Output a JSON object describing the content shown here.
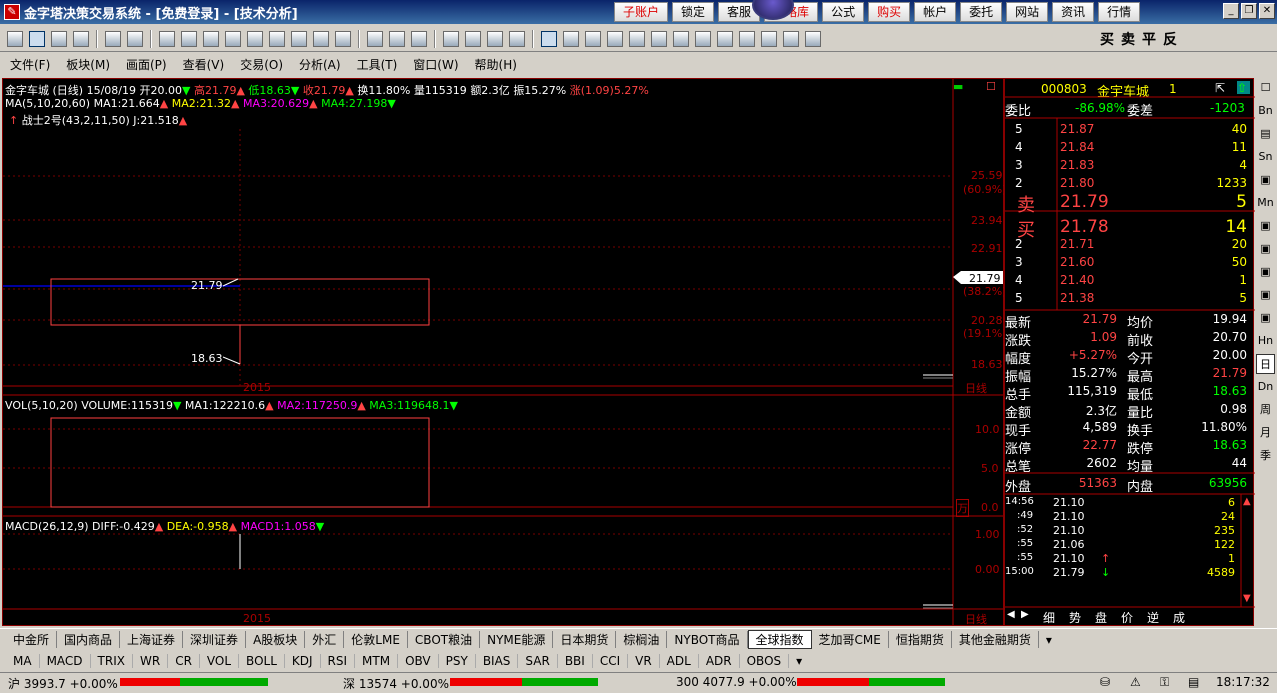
{
  "app": {
    "title": "金字塔决策交易系统 - [免费登录] - [技术分析]",
    "logo": "app-logo-icon"
  },
  "title_buttons": [
    "子账户",
    "锁定",
    "客服",
    "策略库",
    "公式",
    "购买",
    "帐户",
    "委托",
    "网站",
    "资讯",
    "行情"
  ],
  "trade_buttons": [
    "买",
    "卖",
    "平",
    "反"
  ],
  "menu": [
    "文件(F)",
    "板块(M)",
    "画面(P)",
    "查看(V)",
    "交易(O)",
    "分析(A)",
    "工具(T)",
    "窗口(W)",
    "帮助(H)"
  ],
  "chart": {
    "header": "金字车城 (日线) 15/08/19",
    "open": "开20.00",
    "high": "高21.79",
    "low": "低18.63",
    "close": "收21.79",
    "turnover": "换11.80%",
    "volume": "量115319",
    "amount": "额2.3亿",
    "amplitude": "振15.27%",
    "change": "涨(1.09)5.27%",
    "ma_line": "MA(5,10,20,60)",
    "ma1": "MA1:21.664",
    "ma2": "MA2:21.32",
    "ma3": "MA3:20.629",
    "ma4": "MA4:27.198",
    "indicator_line": "战士2号(43,2,11,50) J:21.518",
    "label_high": "21.79",
    "label_low": "18.63",
    "year": "2015",
    "year2": "2015",
    "period": "日线",
    "period2": "日线",
    "y_ticks": [
      "25.59",
      "(60.9%)",
      "23.94",
      "22.91",
      "(38.2%)",
      "20.28",
      "(19.1%)",
      "18.63"
    ],
    "price_tag": "21.79",
    "vol_header": "VOL(5,10,20)",
    "vol_val": "VOLUME:115319",
    "vol_ma1": "MA1:122210.6",
    "vol_ma2": "MA2:117250.9",
    "vol_ma3": "MA3:119648.1",
    "vol_ticks": [
      "10.0",
      "5.0",
      "0.0"
    ],
    "vol_unit": "万",
    "macd_header": "MACD(26,12,9)",
    "diff": "DIFF:-0.429",
    "dea": "DEA:-0.958",
    "macd": "MACD1:1.058",
    "macd_ticks": [
      "1.00",
      "0.00"
    ]
  },
  "chart_data": {
    "type": "candlestick",
    "date": "15/08/19",
    "open": 20.0,
    "high": 21.79,
    "low": 18.63,
    "close": 21.79,
    "volume": 115319,
    "ma": [
      21.664,
      21.32,
      20.629,
      27.198
    ],
    "macd": {
      "diff": -0.429,
      "dea": -0.958,
      "macd": 1.058
    }
  },
  "quote": {
    "code": "000803",
    "name": "金宇车城",
    "num": "1",
    "weibi_label": "委比",
    "weibi": "-86.98%",
    "weicha_label": "委差",
    "weicha": "-1203",
    "asks": [
      {
        "lv": "5",
        "p": "21.87",
        "v": "40"
      },
      {
        "lv": "4",
        "p": "21.84",
        "v": "11"
      },
      {
        "lv": "3",
        "p": "21.83",
        "v": "4"
      },
      {
        "lv": "2",
        "p": "21.80",
        "v": "1233"
      },
      {
        "lv": "卖",
        "p": "21.79",
        "v": "5"
      }
    ],
    "bids": [
      {
        "lv": "买",
        "p": "21.78",
        "v": "14"
      },
      {
        "lv": "2",
        "p": "21.71",
        "v": "20"
      },
      {
        "lv": "3",
        "p": "21.60",
        "v": "50"
      },
      {
        "lv": "4",
        "p": "21.40",
        "v": "1"
      },
      {
        "lv": "5",
        "p": "21.38",
        "v": "5"
      }
    ],
    "stats": [
      {
        "l1": "最新",
        "v1": "21.79",
        "l2": "均价",
        "v2": "19.94"
      },
      {
        "l1": "涨跌",
        "v1": "1.09",
        "l2": "前收",
        "v2": "20.70"
      },
      {
        "l1": "幅度",
        "v1": "+5.27%",
        "l2": "今开",
        "v2": "20.00"
      },
      {
        "l1": "振幅",
        "v1": "15.27%",
        "l2": "最高",
        "v2": "21.79"
      },
      {
        "l1": "总手",
        "v1": "115,319",
        "l2": "最低",
        "v2": "18.63"
      },
      {
        "l1": "金额",
        "v1": "2.3亿",
        "l2": "量比",
        "v2": "0.98"
      },
      {
        "l1": "现手",
        "v1": "4,589",
        "l2": "换手",
        "v2": "11.80%"
      },
      {
        "l1": "涨停",
        "v1": "22.77",
        "l2": "跌停",
        "v2": "18.63"
      },
      {
        "l1": "总笔",
        "v1": "2602",
        "l2": "均量",
        "v2": "44"
      }
    ],
    "outer_label": "外盘",
    "outer": "51363",
    "inner_label": "内盘",
    "inner": "63956",
    "ticks": [
      {
        "t": "14:56",
        "p": "21.10",
        "a": "",
        "v": "6"
      },
      {
        "t": ":49",
        "p": "21.10",
        "a": "",
        "v": "24"
      },
      {
        "t": ":52",
        "p": "21.10",
        "a": "",
        "v": "235"
      },
      {
        "t": ":55",
        "p": "21.06",
        "a": "",
        "v": "122"
      },
      {
        "t": ":55",
        "p": "21.10",
        "a": "↑",
        "v": "1"
      },
      {
        "t": "15:00",
        "p": "21.79",
        "a": "↓",
        "v": "4589"
      }
    ],
    "tabs": [
      "细",
      "势",
      "盘",
      "价",
      "逆",
      "成"
    ]
  },
  "side_tabs": [
    "Bn",
    "Sn",
    "Mn",
    "Hn",
    "日",
    "Dn",
    "周",
    "月",
    "季"
  ],
  "market_tabs": [
    "中金所",
    "国内商品",
    "上海证券",
    "深圳证券",
    "A股板块",
    "外汇",
    "伦敦LME",
    "CBOT粮油",
    "NYME能源",
    "日本期货",
    "棕榈油",
    "NYBOT商品",
    "全球指数",
    "芝加哥CME",
    "恒指期货",
    "其他金融期货"
  ],
  "indicator_tabs": [
    "MA",
    "MACD",
    "TRIX",
    "WR",
    "CR",
    "VOL",
    "BOLL",
    "KDJ",
    "RSI",
    "MTM",
    "OBV",
    "PSY",
    "BIAS",
    "SAR",
    "BBI",
    "CCI",
    "VR",
    "ADL",
    "ADR",
    "OBOS"
  ],
  "status": {
    "sh": "沪 3993.7 +0.00%",
    "sz": "深 13574 +0.00%",
    "hs": "300 4077.9 +0.00%",
    "time": "18:17:32"
  }
}
